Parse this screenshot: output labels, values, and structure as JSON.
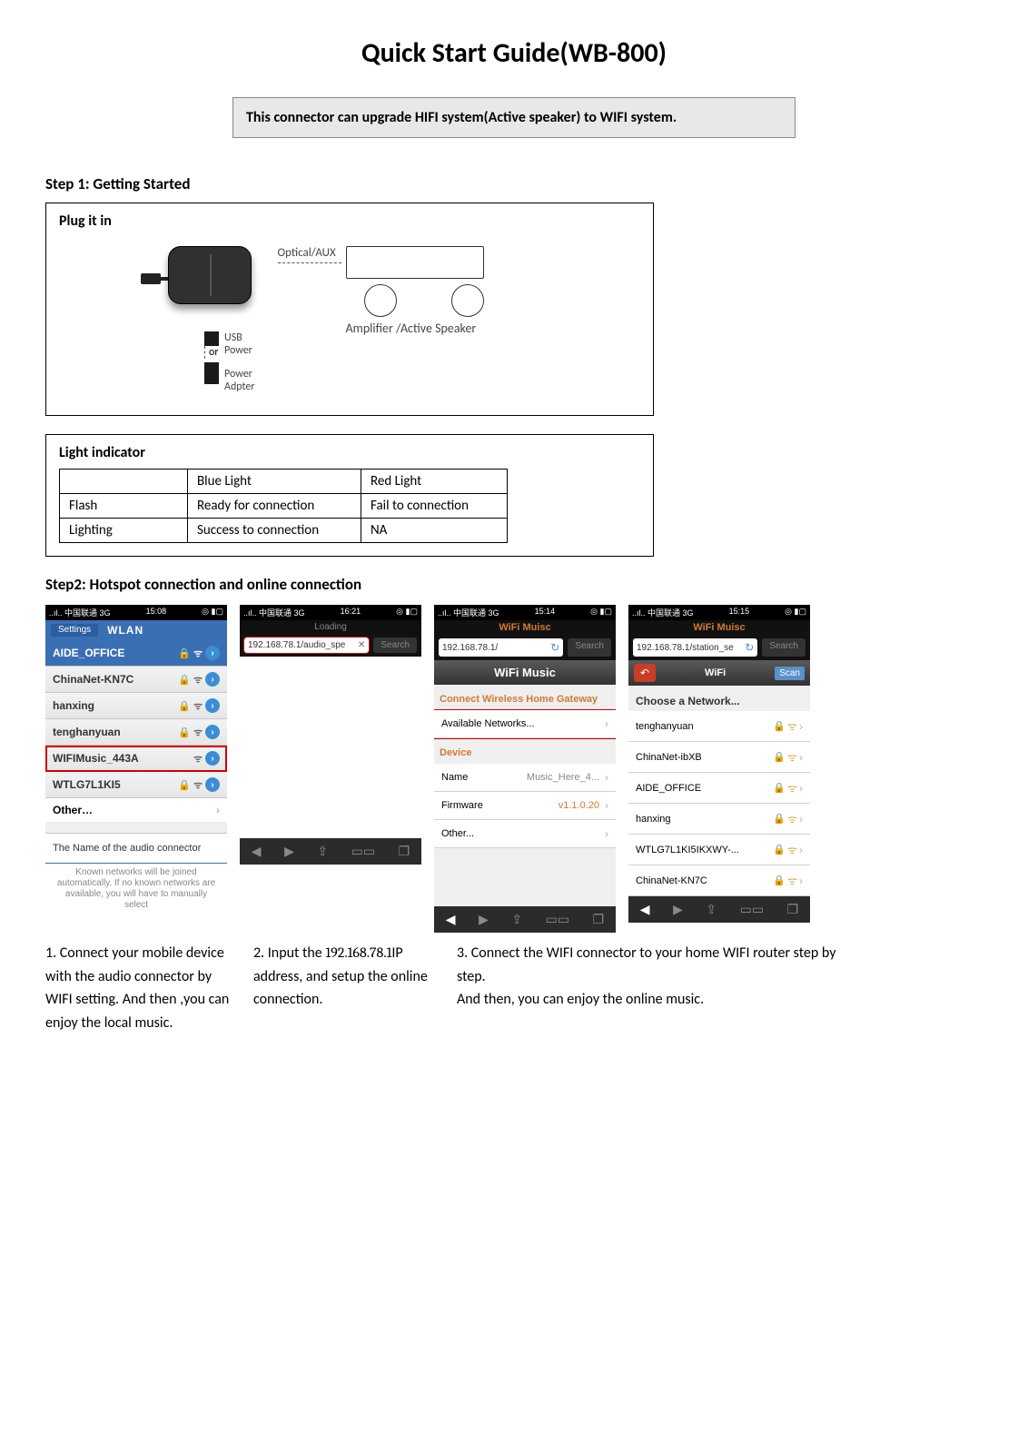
{
  "title": "Quick Start Guide(WB-800)",
  "info_box": "This connector can upgrade    HIFI system(Active speaker) to WIFI system.",
  "step1": {
    "heading": "Step 1: Getting Started",
    "plug_label": "Plug it in",
    "optical": "Optical/AUX",
    "amp_label": "Amplifier /Active Speaker",
    "usb": "USB",
    "power": "Power",
    "or": "or",
    "power_adpter": "Power\nAdpter",
    "light_indicator": "Light indicator",
    "table": {
      "c1": "",
      "c2": "Blue Light",
      "c3": "Red Light",
      "r1c1": "Flash",
      "r1c2": "Ready for connection",
      "r1c3": "Fail to connection",
      "r2c1": "Lighting",
      "r2c2": "Success to connection",
      "r2c3": "NA"
    }
  },
  "step2": {
    "heading": "Step2: Hotspot connection and online connection"
  },
  "status": {
    "carrier": "..ıl.. 中国联通 3G",
    "t1": "15:08",
    "t2": "16:21",
    "t3": "15:14",
    "t4": "15:15",
    "batt": "◎ ▮▢"
  },
  "screen1": {
    "settings": "Settings",
    "wlan": "WLAN",
    "rows": [
      "AIDE_OFFICE",
      "ChinaNet-KN7C",
      "hanxing",
      "tenghanyuan",
      "WIFIMusic_443A",
      "WTLG7L1KI5"
    ],
    "other": "Other…",
    "note1": "The Name of the audio connector",
    "note2": "Known networks will be joined automatically. If no known networks are available, you will have to manually select"
  },
  "screen2": {
    "loading": "Loading",
    "addr": "192.168.78.1/audio_spe",
    "search": "Search"
  },
  "screen3": {
    "header": "WiFi Muisc",
    "addr": "192.168.78.1/",
    "search": "Search",
    "title": "WiFi Music",
    "section1": "Connect Wireless Home Gateway",
    "avail": "Available Networks...",
    "device": "Device",
    "name_l": "Name",
    "name_v": "Music_Here_4...",
    "fw_l": "Firmware",
    "fw_v": "v1.1.0.20",
    "other": "Other..."
  },
  "screen4": {
    "header": "WiFi Muisc",
    "addr": "192.168.78.1/station_se",
    "search": "Search",
    "title": "WiFi",
    "scan": "Scan",
    "choose": "Choose a Network...",
    "nets": [
      "tenghanyuan",
      "ChinaNet-ibXB",
      "AIDE_OFFICE",
      "hanxing",
      "WTLG7L1KI5IKXWY-...",
      "ChinaNet-KN7C"
    ]
  },
  "captions": {
    "c1": "1. Connect your mobile device with the audio connector by WIFI setting. And then ,you can enjoy the local music.",
    "c2_a": "2. Input the ",
    "c2_b": "192.168.78.1",
    "c2_c": "IP address, and setup the online connection.",
    "c3": "3. Connect the WIFI connector to your home WIFI router step by step.\nAnd then, you can enjoy the online music."
  }
}
